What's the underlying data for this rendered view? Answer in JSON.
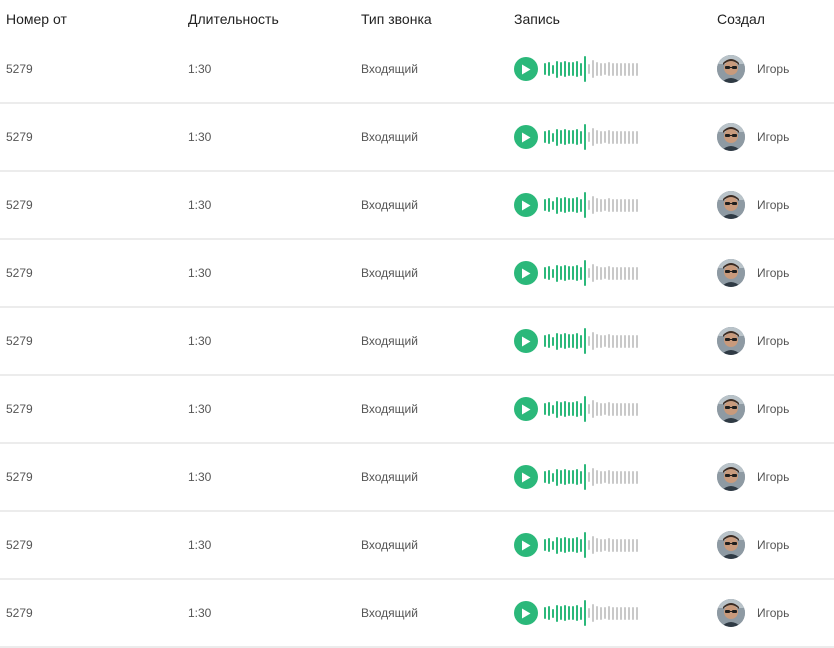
{
  "colors": {
    "accent": "#2bb87a",
    "wave_played": "#2bb87a",
    "wave_remaining": "#c9c9c9"
  },
  "header": {
    "number": "Номер от",
    "duration": "Длительность",
    "type": "Тип звонка",
    "record": "Запись",
    "creator": "Создал"
  },
  "waveform": {
    "levels": [
      0.45,
      0.55,
      0.35,
      0.65,
      0.55,
      0.6,
      0.55,
      0.55,
      0.6,
      0.5,
      1.0,
      0.4,
      0.7,
      0.55,
      0.5,
      0.45,
      0.55,
      0.5,
      0.5,
      0.5,
      0.5,
      0.5,
      0.5,
      0.5
    ],
    "progress": 0.44
  },
  "rows": [
    {
      "number": "5279",
      "duration": "1:30",
      "type": "Входящий",
      "creator": "Игорь",
      "avatar": "user-avatar"
    },
    {
      "number": "5279",
      "duration": "1:30",
      "type": "Входящий",
      "creator": "Игорь",
      "avatar": "user-avatar"
    },
    {
      "number": "5279",
      "duration": "1:30",
      "type": "Входящий",
      "creator": "Игорь",
      "avatar": "user-avatar"
    },
    {
      "number": "5279",
      "duration": "1:30",
      "type": "Входящий",
      "creator": "Игорь",
      "avatar": "user-avatar"
    },
    {
      "number": "5279",
      "duration": "1:30",
      "type": "Входящий",
      "creator": "Игорь",
      "avatar": "user-avatar"
    },
    {
      "number": "5279",
      "duration": "1:30",
      "type": "Входящий",
      "creator": "Игорь",
      "avatar": "user-avatar"
    },
    {
      "number": "5279",
      "duration": "1:30",
      "type": "Входящий",
      "creator": "Игорь",
      "avatar": "user-avatar"
    },
    {
      "number": "5279",
      "duration": "1:30",
      "type": "Входящий",
      "creator": "Игорь",
      "avatar": "user-avatar"
    },
    {
      "number": "5279",
      "duration": "1:30",
      "type": "Входящий",
      "creator": "Игорь",
      "avatar": "user-avatar"
    }
  ]
}
